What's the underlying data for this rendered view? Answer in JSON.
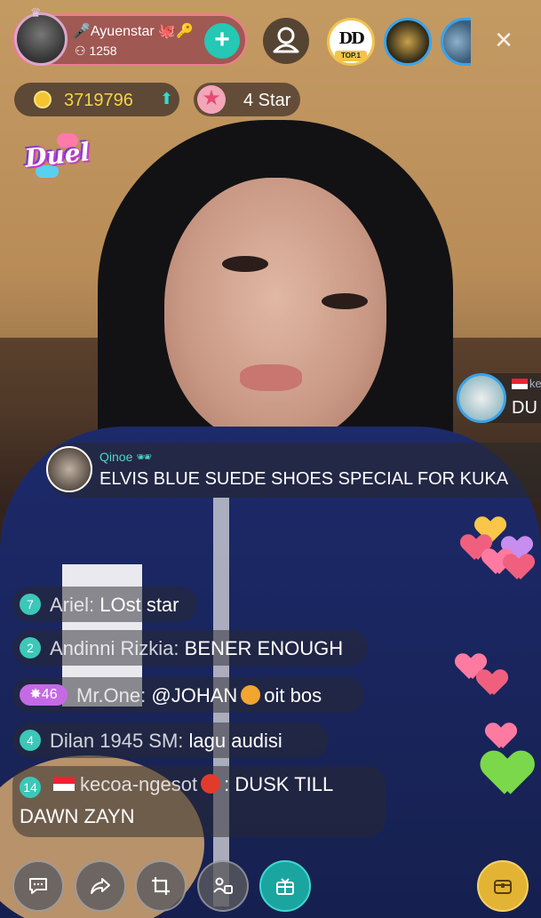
{
  "host": {
    "name": "Ayuenstar",
    "fans": "1258",
    "follow_icon": "plus-icon"
  },
  "viewers": [
    {
      "name": "viewer-top1",
      "logo": "DD",
      "badge": "TOP.1"
    },
    {
      "name": "viewer-2"
    },
    {
      "name": "viewer-3"
    }
  ],
  "wallet": {
    "coins": "3719796",
    "star_label": "4 Star"
  },
  "duel": {
    "label": "Duel"
  },
  "incoming_gift": {
    "name": "ke",
    "text": "DU"
  },
  "pinned": {
    "user": "Qinoe",
    "message": "ELVIS BLUE SUEDE SHOES SPECIAL FOR KUKA"
  },
  "chat": [
    {
      "level": "7",
      "user": "Ariel:",
      "text": "LOst star"
    },
    {
      "level": "2",
      "user": "Andinni Rizkia:",
      "text": "BENER ENOUGH"
    },
    {
      "level": "46",
      "user": "Mr.One:",
      "text": "@JOHAN",
      "text2": "oit bos"
    },
    {
      "level": "4",
      "user": "Dilan 1945 SM:",
      "text": "lagu audisi"
    },
    {
      "level": "14",
      "user": "kecoa-ngesot",
      "text": ": DUSK TILL",
      "text_line2": "DAWN ZAYN"
    }
  ],
  "toolbar": [
    {
      "name": "chat-button",
      "icon": "chat-icon"
    },
    {
      "name": "share-button",
      "icon": "share-icon"
    },
    {
      "name": "crop-button",
      "icon": "crop-icon"
    },
    {
      "name": "guests-button",
      "icon": "guests-icon"
    },
    {
      "name": "gift-button",
      "icon": "gift-icon"
    },
    {
      "name": "treasure-button",
      "icon": "treasure-icon"
    }
  ],
  "colors": {
    "accent": "#25c7b5",
    "host_pill": "#f07b8f",
    "coin": "#f6d24a",
    "level_badge": "#3cc7b8",
    "vip_badge": "#c46ae5"
  }
}
